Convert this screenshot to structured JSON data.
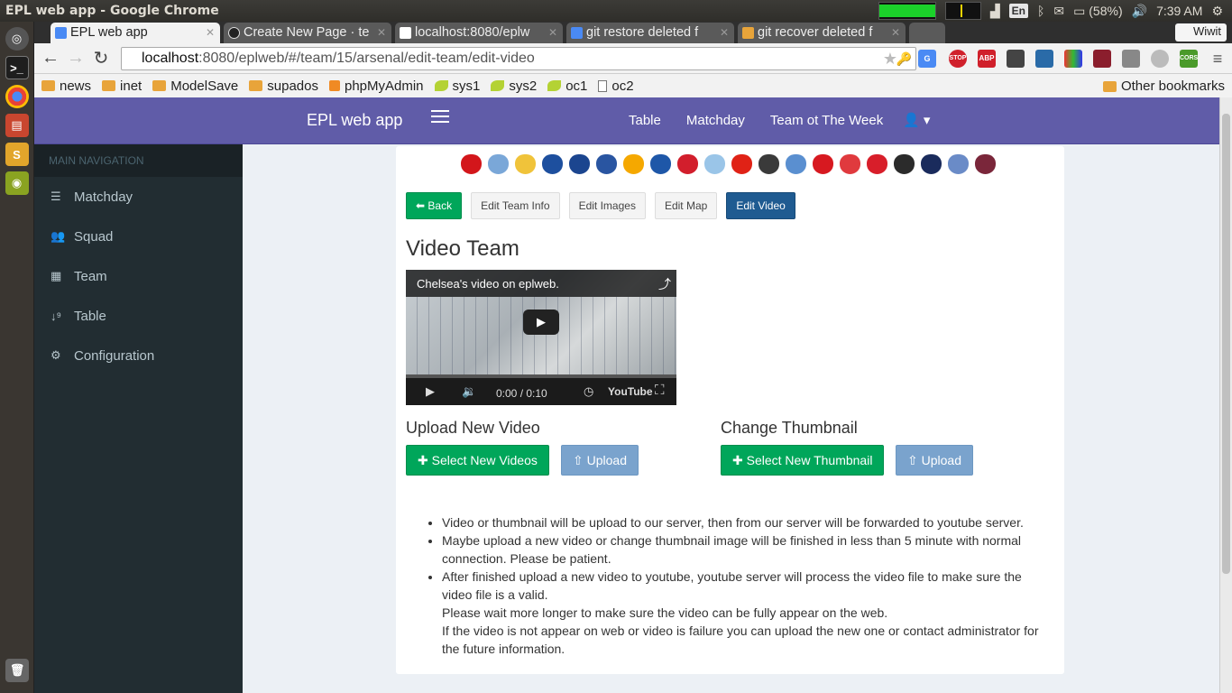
{
  "os": {
    "window_title": "EPL web app - Google Chrome",
    "lang": "En",
    "battery": "(58%)",
    "time": "7:39 AM"
  },
  "chrome": {
    "tabs": [
      {
        "title": "EPL web app",
        "active": true
      },
      {
        "title": "Create New Page · te",
        "active": false
      },
      {
        "title": "localhost:8080/eplw",
        "active": false
      },
      {
        "title": "git restore deleted f",
        "active": false
      },
      {
        "title": "git recover deleted f",
        "active": false
      }
    ],
    "profile": "Wiwit",
    "url_host": "localhost",
    "url_rest": ":8080/eplweb/#/team/15/arsenal/edit-team/edit-video",
    "extensions": [
      "G",
      "STOP",
      "ABP",
      "",
      "",
      "",
      "",
      "",
      "",
      "CORS",
      "≡"
    ],
    "bookmarks": [
      {
        "label": "news",
        "icon": "folder"
      },
      {
        "label": "inet",
        "icon": "folder"
      },
      {
        "label": "ModelSave",
        "icon": "folder"
      },
      {
        "label": "supados",
        "icon": "folder"
      },
      {
        "label": "phpMyAdmin",
        "icon": "pma"
      },
      {
        "label": "sys1",
        "icon": "leaf"
      },
      {
        "label": "sys2",
        "icon": "leaf"
      },
      {
        "label": "oc1",
        "icon": "leaf"
      },
      {
        "label": "oc2",
        "icon": "page"
      }
    ],
    "other_bookmarks": "Other bookmarks"
  },
  "app": {
    "brand": "EPL web app",
    "top_nav": [
      "Table",
      "Matchday",
      "Team ot The Week"
    ],
    "sidebar_header": "MAIN NAVIGATION",
    "sidebar_items": [
      {
        "label": "Matchday",
        "icon": "list-icon"
      },
      {
        "label": "Squad",
        "icon": "users-icon"
      },
      {
        "label": "Team",
        "icon": "table-icon"
      },
      {
        "label": "Table",
        "icon": "sort-icon"
      },
      {
        "label": "Configuration",
        "icon": "gear-icon"
      }
    ],
    "crest_colors": [
      "#d3161b",
      "#7aa7d8",
      "#f0c33a",
      "#1d4f9e",
      "#1b458f",
      "#2955a1",
      "#f5a800",
      "#1e57a8",
      "#d21e2c",
      "#9ac5e8",
      "#e02216",
      "#3a3a3a",
      "#5a8fd0",
      "#d71920",
      "#e03a3e",
      "#d81e2a",
      "#2b2b2b",
      "#1a2b5c",
      "#6a8bc7",
      "#7a263a"
    ],
    "edit_buttons": {
      "back": "Back",
      "edit_team_info": "Edit Team Info",
      "edit_images": "Edit Images",
      "edit_map": "Edit Map",
      "edit_video": "Edit Video"
    },
    "page_title": "Video Team",
    "video": {
      "title": "Chelsea's video on eplweb.",
      "time": "0:00 / 0:10",
      "brand": "YouTube"
    },
    "upload_video": {
      "heading": "Upload New Video",
      "select_label": "Select New Videos",
      "upload_label": "Upload"
    },
    "change_thumb": {
      "heading": "Change Thumbnail",
      "select_label": "Select New Thumbnail",
      "upload_label": "Upload"
    },
    "notes": [
      "Video or thumbnail will be upload to our server, then from our server will be forwarded to youtube server.",
      "Maybe upload a new video or change thumbnail image will be finished in less than 5 minute with normal connection. Please be patient.",
      "After finished upload a new video to youtube, youtube server will process the video file to make sure the video file is a valid."
    ],
    "note_extra_1": "Please wait more longer to make sure the video can be fully appear on the web.",
    "note_extra_2": "If the video is not appear on web or video is failure you can upload the new one or contact administrator for the future information."
  }
}
